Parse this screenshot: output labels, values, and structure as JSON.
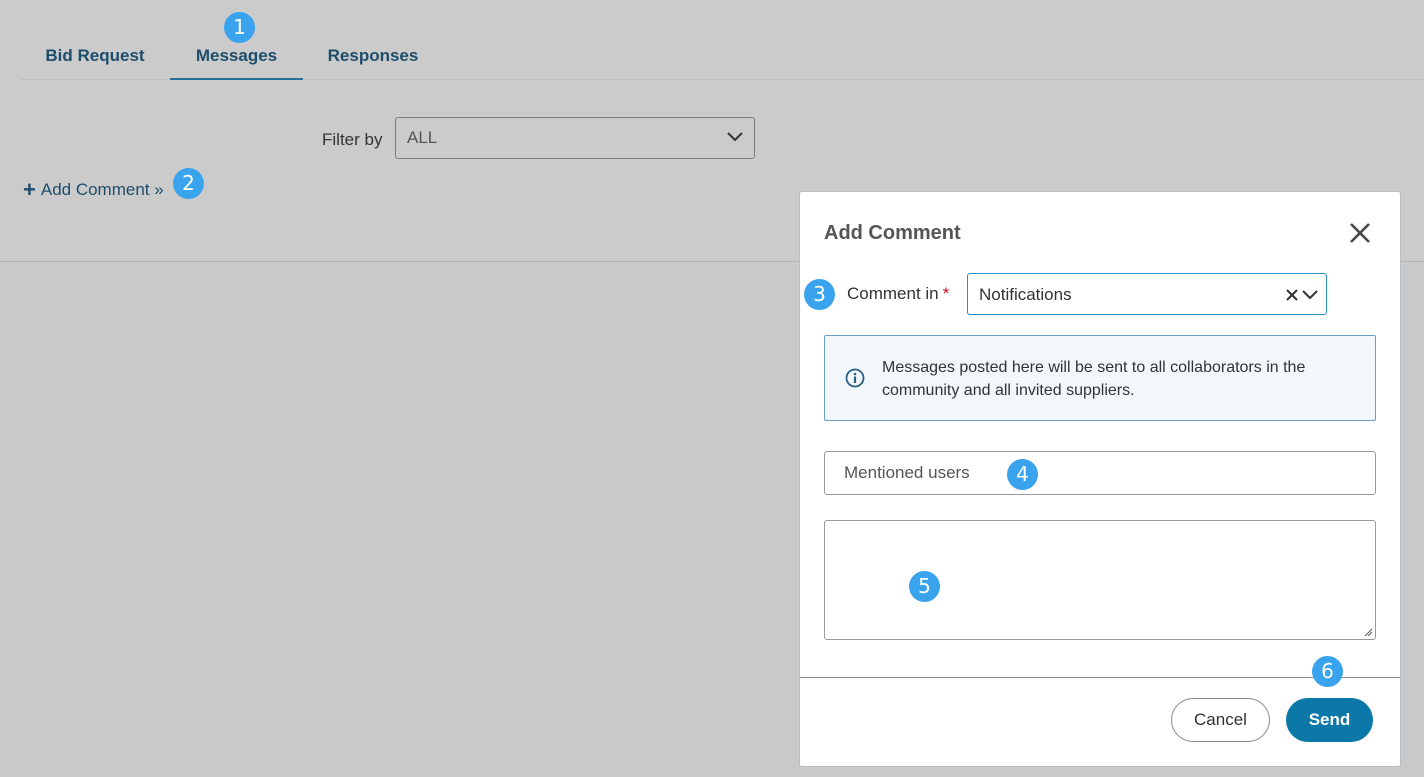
{
  "tabs": [
    {
      "label": "Bid Request"
    },
    {
      "label": "Messages"
    },
    {
      "label": "Responses"
    }
  ],
  "filter": {
    "label": "Filter by",
    "value": "ALL"
  },
  "add_comment_link": {
    "label": "Add Comment »"
  },
  "badges": [
    "1",
    "2",
    "3",
    "4",
    "5",
    "6"
  ],
  "modal": {
    "title": "Add Comment",
    "comment_in_label": "Comment in",
    "required_mark": "*",
    "comment_in_value": "Notifications",
    "info_text": "Messages posted here will be sent to all collaborators in the community and all invited suppliers.",
    "mentioned_users_placeholder": "Mentioned users",
    "cancel_label": "Cancel",
    "send_label": "Send"
  },
  "colors": {
    "accent": "#0b78a8",
    "badge": "#3aa3ee",
    "tab_text": "#1e4d6b",
    "required": "#c8102e"
  }
}
